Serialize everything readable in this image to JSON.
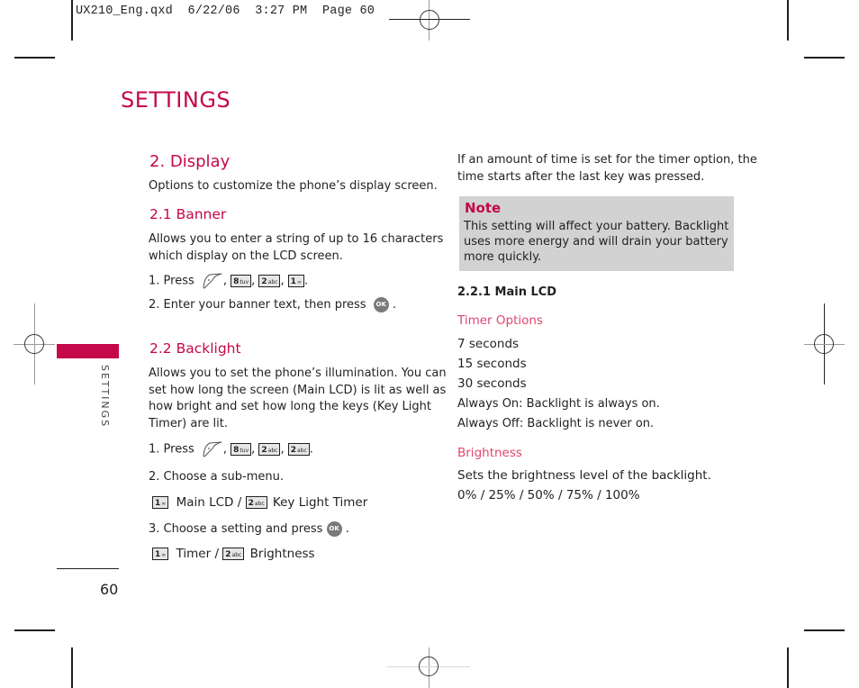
{
  "slug": {
    "filename": "UX210_Eng.qxd",
    "date": "6/22/06",
    "time": "3:27 PM",
    "page_label": "Page 60"
  },
  "page": {
    "section_title": "SETTINGS",
    "sidebar_tab": "SETTINGS",
    "page_number": "60",
    "accent_color": "#c4084a"
  },
  "left_column": {
    "heading": "2. Display",
    "intro": "Options to customize the phone’s display screen.",
    "banner": {
      "heading": "2.1 Banner",
      "description_lines": [
        "Allows you to enter a string of up to 16 characters",
        "which display on the LCD screen."
      ],
      "step1_prefix": "1. Press",
      "step1_keys": [
        {
          "icon": "menu-softkey-icon"
        },
        {
          "digit": "8",
          "letters": "tuv"
        },
        {
          "digit": "2",
          "letters": "abc"
        },
        {
          "digit": "1",
          "letters": "voicemail"
        }
      ],
      "step2": "2. Enter your banner text, then press",
      "ok_label": "OK"
    },
    "backlight": {
      "heading": "2.2 Backlight",
      "description_lines": [
        "Allows you to set the phone’s illumination. You can",
        "set how long the screen (Main LCD) is lit as well as",
        "how bright and set how long the keys (Key Light",
        "Timer) are lit."
      ],
      "step1_prefix": "1. Press",
      "step1_keys": [
        {
          "icon": "menu-softkey-icon"
        },
        {
          "digit": "8",
          "letters": "tuv"
        },
        {
          "digit": "2",
          "letters": "abc"
        },
        {
          "digit": "2",
          "letters": "abc"
        }
      ],
      "step2": "2. Choose a sub-menu.",
      "submenu_1": "Main LCD /",
      "submenu_2": "Key Light Timer",
      "step3": "3. Choose a setting and press",
      "setting_1": "Timer /",
      "setting_2": "Brightness",
      "ok_label": "OK"
    }
  },
  "right_column": {
    "intro_lines": [
      "If an amount of time is set for the timer option, the",
      "time starts after the last key was pressed."
    ],
    "note": {
      "title": "Note",
      "lines": [
        "This setting will affect your battery. Backlight",
        "uses more energy and will drain your battery",
        "more quickly."
      ]
    },
    "main_lcd_heading": "2.2.1 Main LCD",
    "timer_options_heading": "Timer Options",
    "timer_options": [
      "7 seconds",
      "15 seconds",
      "30 seconds",
      "Always On: Backlight is always on.",
      "Always Off: Backlight is never on."
    ],
    "brightness_heading": "Brightness",
    "brightness_description": "Sets the brightness level of the backlight.",
    "brightness_levels": "0% / 25% / 50% / 75% / 100%"
  },
  "key_labels": {
    "k1_digit": "1",
    "k2_digit": "2",
    "k8_digit": "8",
    "k2_letters": "abc",
    "k8_letters": "tuv",
    "k1_glyph": "∞"
  }
}
